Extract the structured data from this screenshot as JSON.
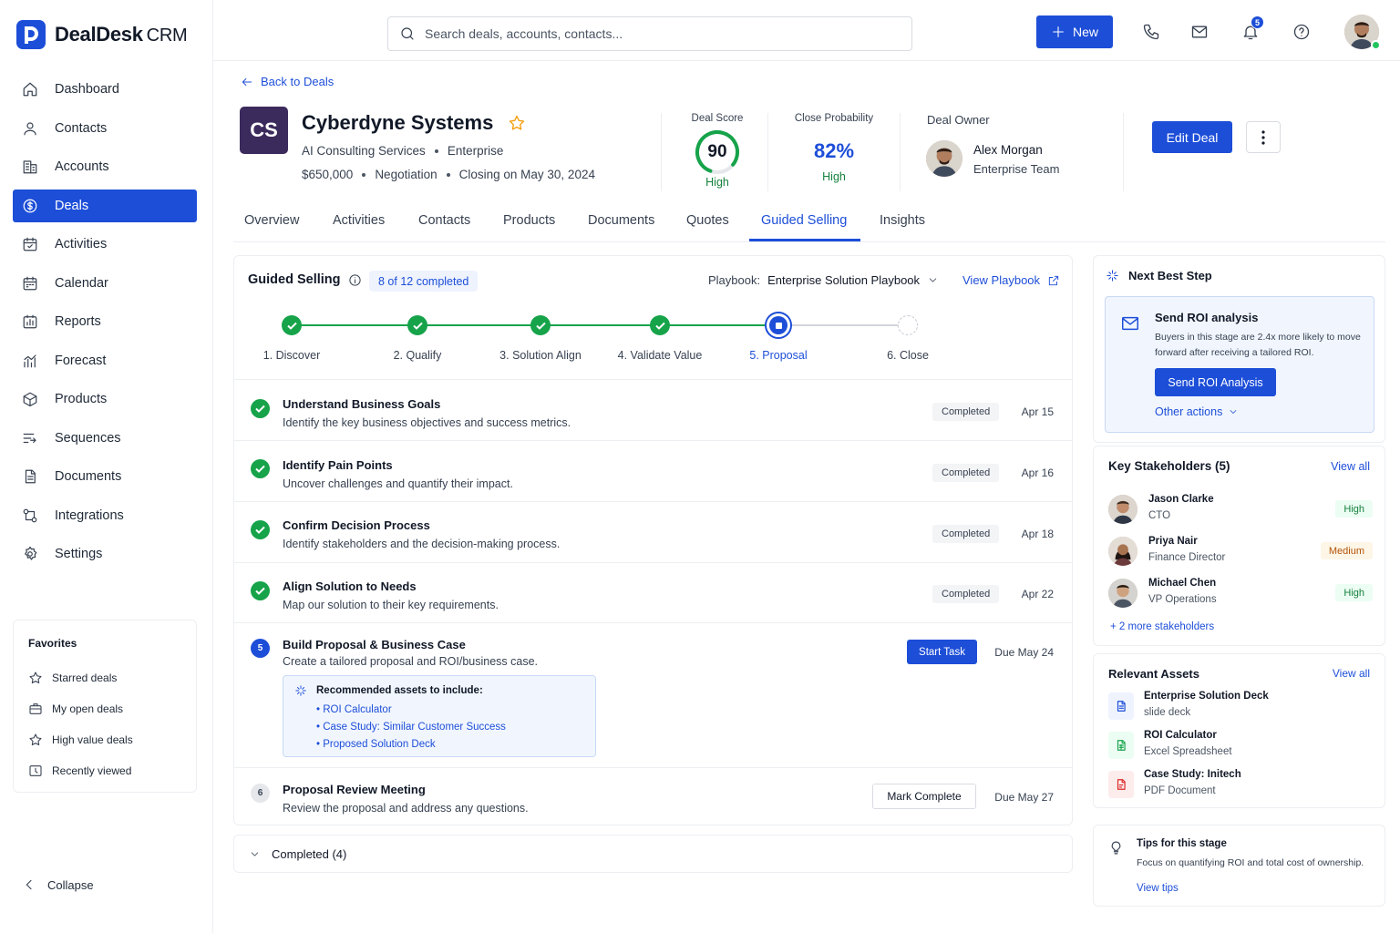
{
  "brand": {
    "name": "DealDesk",
    "suffix": "CRM"
  },
  "sidebar": {
    "items": [
      {
        "label": "Dashboard",
        "icon": "home-icon"
      },
      {
        "label": "Contacts",
        "icon": "user-icon"
      },
      {
        "label": "Accounts",
        "icon": "building-icon"
      },
      {
        "label": "Deals",
        "icon": "dollar-icon",
        "active": true
      },
      {
        "label": "Activities",
        "icon": "calendar-check-icon"
      },
      {
        "label": "Calendar",
        "icon": "calendar-icon"
      },
      {
        "label": "Reports",
        "icon": "chart-icon"
      },
      {
        "label": "Forecast",
        "icon": "forecast-icon"
      },
      {
        "label": "Products",
        "icon": "box-icon"
      },
      {
        "label": "Sequences",
        "icon": "sequence-icon"
      },
      {
        "label": "Documents",
        "icon": "document-icon"
      },
      {
        "label": "Integrations",
        "icon": "integrations-icon"
      },
      {
        "label": "Settings",
        "icon": "gear-icon"
      }
    ],
    "favorites": {
      "title": "Favorites",
      "items": [
        "Starred deals",
        "My open deals",
        "High value deals",
        "Recently viewed"
      ]
    },
    "collapse_label": "Collapse"
  },
  "topbar": {
    "search_placeholder": "Search deals, accounts, contacts...",
    "new_label": "New",
    "notifications_count": "5"
  },
  "deal": {
    "back_label": "Back to Deals",
    "logo_initials": "CS",
    "account_name": "Cyberdyne Systems",
    "segment": "AI Consulting Services",
    "tier": "Enterprise",
    "amount": "$650,000",
    "stage": "Negotiation",
    "closing": "Closing on May 30, 2024",
    "deal_score_label": "Deal Score",
    "deal_score": "90",
    "deal_score_value": 90,
    "deal_score_rating": "High",
    "close_prob_label": "Close Probability",
    "close_prob": "82%",
    "close_prob_rating": "High",
    "owner_label": "Deal Owner",
    "owner_name": "Alex Morgan",
    "owner_team": "Enterprise Team",
    "edit_label": "Edit Deal"
  },
  "tabs": [
    "Overview",
    "Activities",
    "Contacts",
    "Products",
    "Documents",
    "Quotes",
    "Guided Selling",
    "Insights"
  ],
  "guided": {
    "title": "Guided Selling",
    "progress": "8 of 12 completed",
    "playbook_label": "Playbook:",
    "playbook_name": "Enterprise Solution Playbook",
    "view_playbook": "View Playbook",
    "steps": [
      "1. Discover",
      "2. Qualify",
      "3. Solution Align",
      "4. Validate Value",
      "5. Proposal",
      "6. Close"
    ],
    "tasks": [
      {
        "title": "Understand Business Goals",
        "desc": "Identify the key business objectives and success metrics.",
        "status": "Completed",
        "date": "Apr 15"
      },
      {
        "title": "Identify Pain Points",
        "desc": "Uncover challenges and quantify their impact.",
        "status": "Completed",
        "date": "Apr 16"
      },
      {
        "title": "Confirm Decision Process",
        "desc": "Identify stakeholders and the decision-making process.",
        "status": "Completed",
        "date": "Apr 18"
      },
      {
        "title": "Align Solution to Needs",
        "desc": "Map our solution to their key requirements.",
        "status": "Completed",
        "date": "Apr 22"
      }
    ],
    "current_task": {
      "num": "5",
      "title": "Build Proposal & Business Case",
      "desc": "Create a tailored proposal and ROI/business case.",
      "action": "Start Task",
      "date": "Due May 24",
      "rec_title": "Recommended assets to include:",
      "rec_items": [
        "ROI Calculator",
        "Case Study: Similar Customer Success",
        "Proposed Solution Deck"
      ]
    },
    "next_task": {
      "num": "6",
      "title": "Proposal Review Meeting",
      "desc": "Review the proposal and address any questions.",
      "action": "Mark Complete",
      "date": "Due May 27"
    },
    "completed_toggle": "Completed (4)"
  },
  "next_best": {
    "title": "Next Best Step",
    "action_title": "Send ROI analysis",
    "action_desc": "Buyers in this stage are 2.4x more likely to move forward after receiving a tailored ROI.",
    "button": "Send ROI Analysis",
    "other": "Other actions"
  },
  "stakeholders": {
    "title": "Key Stakeholders (5)",
    "view_all": "View all",
    "items": [
      {
        "name": "Jason Clarke",
        "role": "CTO",
        "level": "High"
      },
      {
        "name": "Priya Nair",
        "role": "Finance Director",
        "level": "Medium"
      },
      {
        "name": "Michael Chen",
        "role": "VP Operations",
        "level": "High"
      }
    ],
    "more": "+ 2 more stakeholders"
  },
  "assets": {
    "title": "Relevant Assets",
    "view_all": "View all",
    "items": [
      {
        "name": "Enterprise Solution Deck",
        "type": "slide deck",
        "color": "#1d4ed8"
      },
      {
        "name": "ROI Calculator",
        "type": "Excel Spreadsheet",
        "color": "#16a34a"
      },
      {
        "name": "Case Study: Initech",
        "type": "PDF Document",
        "color": "#dc2626"
      }
    ]
  },
  "tips": {
    "title": "Tips for this stage",
    "text": "Focus on quantifying ROI and total cost of ownership.",
    "link": "View tips"
  }
}
